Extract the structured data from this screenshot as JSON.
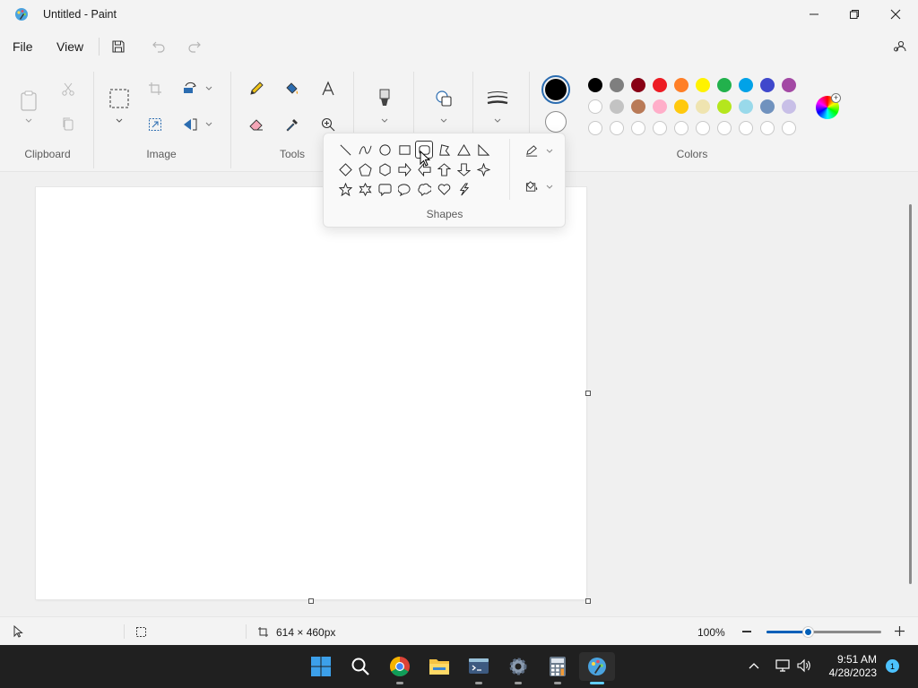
{
  "window": {
    "title": "Untitled - Paint",
    "controls": [
      "minimize",
      "maximize",
      "close"
    ]
  },
  "menu": {
    "file": "File",
    "view": "View"
  },
  "ribbon": {
    "groups": {
      "clipboard": "Clipboard",
      "image": "Image",
      "tools": "Tools",
      "colors": "Colors"
    },
    "shapes_label": "Shapes"
  },
  "colors": {
    "primary": "#000000",
    "secondary": "#ffffff",
    "palette_row1": [
      "#000000",
      "#7f7f7f",
      "#880015",
      "#ed1c24",
      "#ff7f27",
      "#fff200",
      "#22b14c",
      "#00a2e8",
      "#3f48cc",
      "#a349a4"
    ],
    "palette_row2": [
      "#ffffff",
      "#c3c3c3",
      "#b97a57",
      "#ffaec9",
      "#ffc90e",
      "#efe4b0",
      "#b5e61d",
      "#99d9ea",
      "#7092be",
      "#c8bfe7"
    ],
    "palette_row3": [
      "",
      "",
      "",
      "",
      "",
      "",
      "",
      "",
      "",
      ""
    ]
  },
  "shapes": {
    "items": [
      "line",
      "curve",
      "oval",
      "rectangle",
      "rounded-rectangle",
      "polygon",
      "triangle",
      "right-triangle",
      "diamond",
      "pentagon",
      "hexagon",
      "right-arrow",
      "left-arrow",
      "up-arrow",
      "down-arrow",
      "four-point-star",
      "five-point-star",
      "six-point-star",
      "rounded-rectangular-callout",
      "oval-callout",
      "cloud-callout",
      "heart",
      "lightning"
    ],
    "selected": "rounded-rectangle"
  },
  "status": {
    "canvas_size": "614 × 460px",
    "zoom": "100%",
    "zoom_fraction": 0.36
  },
  "taskbar": {
    "time": "9:51 AM",
    "date": "4/28/2023",
    "notification_count": "1"
  }
}
